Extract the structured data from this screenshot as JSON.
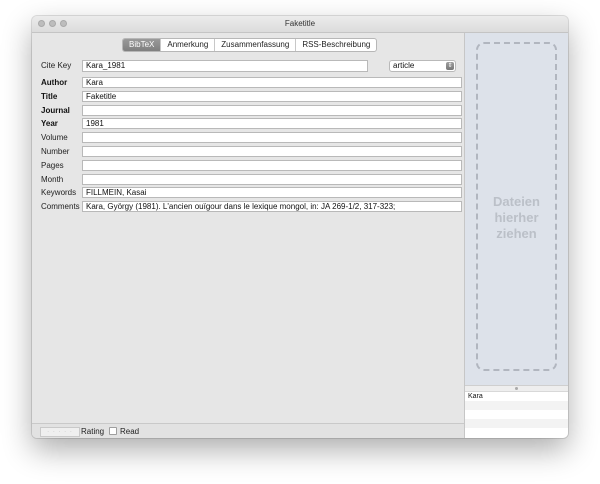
{
  "window": {
    "title": "Faketitle"
  },
  "tabs": [
    {
      "label": "BibTeX",
      "active": true
    },
    {
      "label": "Anmerkung",
      "active": false
    },
    {
      "label": "Zusammenfassung",
      "active": false
    },
    {
      "label": "RSS-Beschreibung",
      "active": false
    }
  ],
  "citekey": {
    "label": "Cite Key",
    "value": "Kara_1981"
  },
  "entry_type": {
    "value": "article"
  },
  "fields": [
    {
      "label": "Author",
      "value": "Kara",
      "bold": true
    },
    {
      "label": "Title",
      "value": "Faketitle",
      "bold": true
    },
    {
      "label": "Journal",
      "value": "",
      "bold": true
    },
    {
      "label": "Year",
      "value": "1981",
      "bold": true
    },
    {
      "label": "Volume",
      "value": "",
      "bold": false
    },
    {
      "label": "Number",
      "value": "",
      "bold": false
    },
    {
      "label": "Pages",
      "value": "",
      "bold": false
    },
    {
      "label": "Month",
      "value": "",
      "bold": false
    },
    {
      "label": "Keywords",
      "value": "FILLMEIN, Kasai",
      "bold": false
    },
    {
      "label": "Comments",
      "value": "Kara, György (1981). L'ancien ouïgour dans le lexique mongol, in: JA 269-1/2, 317-323;",
      "bold": false
    }
  ],
  "bottom": {
    "rating_label": "Rating",
    "read_label": "Read",
    "read_checked": false,
    "rating_value": 0
  },
  "side": {
    "drop_text_lines": [
      "Dateien",
      "hierher",
      "ziehen"
    ],
    "authors": [
      "Kara",
      "",
      "",
      "",
      ""
    ]
  }
}
